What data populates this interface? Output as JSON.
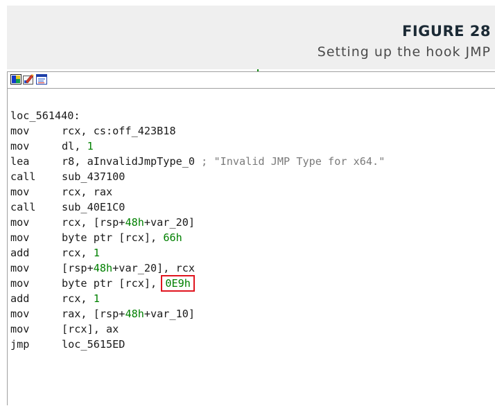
{
  "caption": {
    "figure_label": "FIGURE 28",
    "title": "Setting up the hook JMP"
  },
  "toolbar": {
    "icons": [
      "graph-view-icon",
      "edit-icon",
      "text-view-icon"
    ]
  },
  "code": {
    "label": "loc_561440:",
    "lines": [
      {
        "mnemonic": "mov",
        "operands": "rcx, cs:off_423B18"
      },
      {
        "mnemonic": "mov",
        "operands_prefix": "dl, ",
        "number": "1"
      },
      {
        "mnemonic": "lea",
        "operands": "r8, aInvalidJmpType_0 ",
        "comment": "; \"Invalid JMP Type for x64.\""
      },
      {
        "mnemonic": "call",
        "operands": "sub_437100"
      },
      {
        "mnemonic": "mov",
        "operands": "rcx, rax"
      },
      {
        "mnemonic": "call",
        "operands": "sub_40E1C0"
      },
      {
        "mnemonic": "mov",
        "operands_prefix": "rcx, [rsp+",
        "number": "48h",
        "operands_suffix": "+var_20]"
      },
      {
        "mnemonic": "mov",
        "operands_prefix": "byte ptr [rcx], ",
        "number": "66h"
      },
      {
        "mnemonic": "add",
        "operands_prefix": "rcx, ",
        "number": "1"
      },
      {
        "mnemonic": "mov",
        "operands_prefix": "[rsp+",
        "number": "48h",
        "operands_suffix": "+var_20], rcx"
      },
      {
        "mnemonic": "mov",
        "operands_prefix": "byte ptr [rcx], ",
        "number": "0E9h"
      },
      {
        "mnemonic": "add",
        "operands_prefix": "rcx, ",
        "number": "1"
      },
      {
        "mnemonic": "mov",
        "operands_prefix": "rax, [rsp+",
        "number": "48h",
        "operands_suffix": "+var_10]"
      },
      {
        "mnemonic": "mov",
        "operands": "[rcx], ax"
      },
      {
        "mnemonic": "jmp",
        "operands": "loc_5615ED"
      }
    ]
  },
  "colors": {
    "highlight_box": "#e0141e",
    "numeric_literal": "#008000",
    "comment": "#7a7a7a"
  }
}
